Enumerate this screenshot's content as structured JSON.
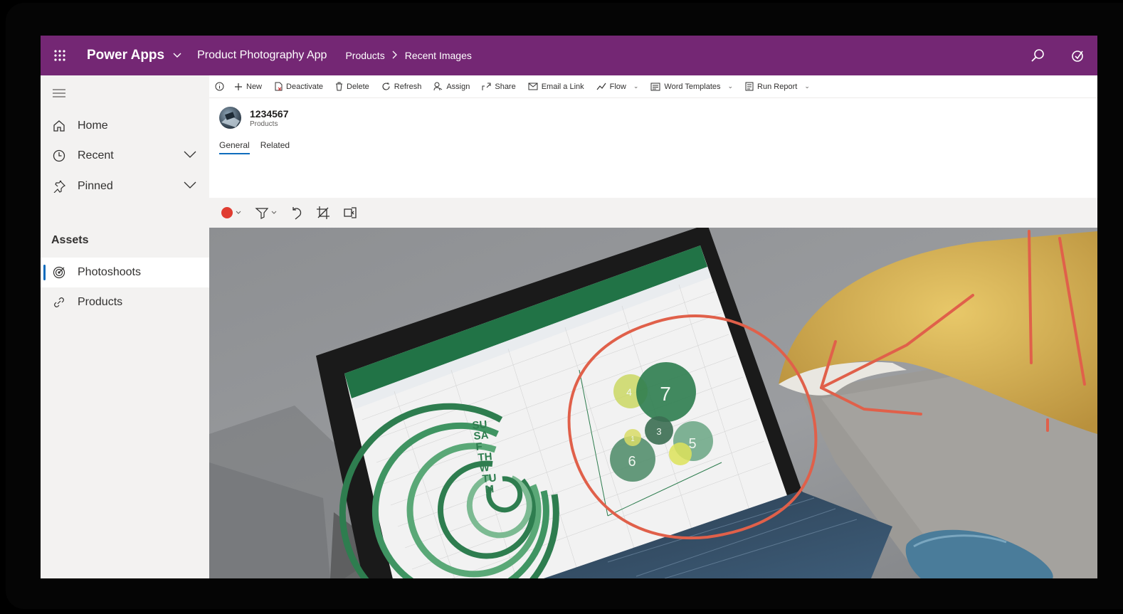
{
  "header": {
    "brand": "Power Apps",
    "app_name": "Product Photography App",
    "breadcrumb": [
      "Products",
      "Recent Images"
    ],
    "bg_color": "#742774"
  },
  "sidebar": {
    "items": [
      {
        "label": "Home",
        "icon": "home-icon"
      },
      {
        "label": "Recent",
        "icon": "clock-icon"
      },
      {
        "label": "Pinned",
        "icon": "pin-icon"
      }
    ],
    "section_title": "Assets",
    "assets": [
      {
        "label": "Photoshoots",
        "icon": "target-icon",
        "active": true
      },
      {
        "label": "Products",
        "icon": "link-icon",
        "active": false
      }
    ]
  },
  "commands": [
    {
      "label": "New",
      "icon": "plus-icon"
    },
    {
      "label": "Deactivate",
      "icon": "deactivate-icon"
    },
    {
      "label": "Delete",
      "icon": "trash-icon"
    },
    {
      "label": "Refresh",
      "icon": "refresh-icon"
    },
    {
      "label": "Assign",
      "icon": "person-icon"
    },
    {
      "label": "Share",
      "icon": "share-icon"
    },
    {
      "label": "Email a Link",
      "icon": "email-icon"
    },
    {
      "label": "Flow",
      "icon": "flow-icon"
    },
    {
      "label": "Word Templates",
      "icon": "word-icon"
    },
    {
      "label": "Run Report",
      "icon": "report-icon"
    }
  ],
  "record": {
    "id": "1234567",
    "entity": "Products"
  },
  "tabs": [
    "General",
    "Related"
  ],
  "ink_toolbar": {
    "pen_color": "#e03c31",
    "tools": [
      "pen-color-icon",
      "highlighter-icon",
      "undo-icon",
      "crop-icon",
      "fit-icon"
    ]
  },
  "photo": {
    "bubble_labels": [
      "4",
      "7",
      "3",
      "5",
      "6",
      "1"
    ],
    "ring_labels": [
      "SU",
      "SA",
      "F",
      "TH",
      "W",
      "TU",
      "M"
    ],
    "annotation_color": "#e0604a"
  }
}
